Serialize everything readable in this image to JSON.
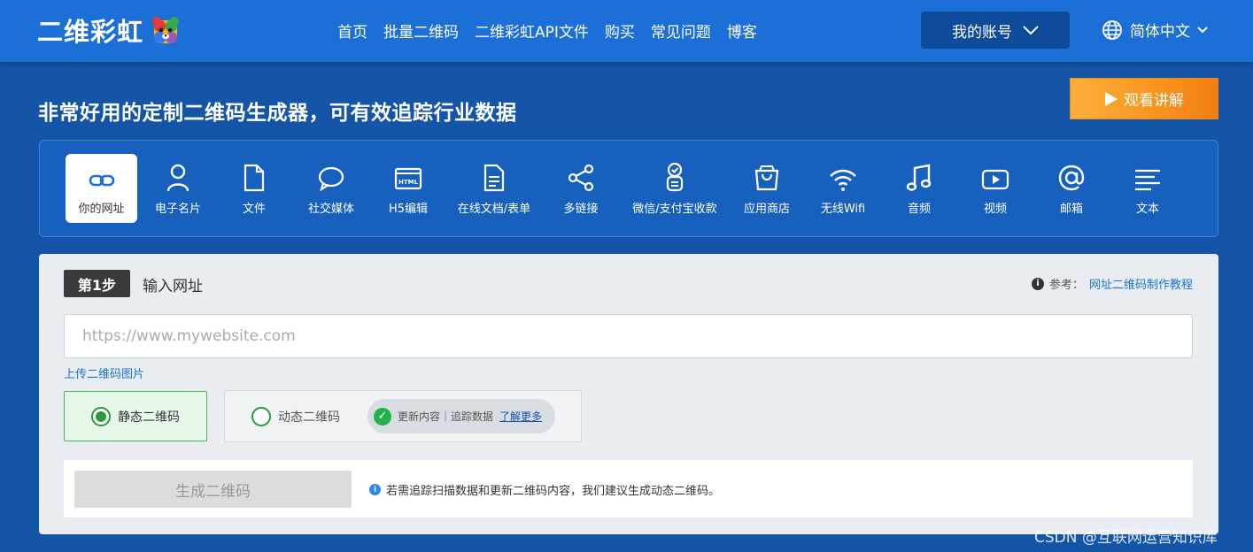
{
  "header": {
    "logo_text": "二维彩虹",
    "nav": [
      "首页",
      "批量二维码",
      "二维彩虹API文件",
      "购买",
      "常见问题",
      "博客"
    ],
    "account_label": "我的账号",
    "language_label": "简体中文"
  },
  "hero": {
    "headline": "非常好用的定制二维码生成器，可有效追踪行业数据",
    "watch_label": "观看讲解"
  },
  "types": [
    {
      "label": "你的网址",
      "icon": "link-icon",
      "active": true
    },
    {
      "label": "电子名片",
      "icon": "person-icon"
    },
    {
      "label": "文件",
      "icon": "file-icon"
    },
    {
      "label": "社交媒体",
      "icon": "chat-bubble-icon"
    },
    {
      "label": "H5编辑",
      "icon": "html-icon"
    },
    {
      "label": "在线文档/表单",
      "icon": "document-icon"
    },
    {
      "label": "多链接",
      "icon": "share-icon"
    },
    {
      "label": "微信/支付宝收款",
      "icon": "payment-icon"
    },
    {
      "label": "应用商店",
      "icon": "shopping-bag-icon"
    },
    {
      "label": "无线Wifi",
      "icon": "wifi-icon"
    },
    {
      "label": "音频",
      "icon": "music-icon"
    },
    {
      "label": "视频",
      "icon": "video-icon"
    },
    {
      "label": "邮箱",
      "icon": "at-icon"
    },
    {
      "label": "文本",
      "icon": "text-icon"
    }
  ],
  "step": {
    "badge": "第1步",
    "title": "输入网址",
    "ref_label": "参考：",
    "ref_link": "网址二维码制作教程"
  },
  "form": {
    "url_placeholder": "https://www.mywebsite.com",
    "upload_link": "上传二维码图片",
    "static_label": "静态二维码",
    "dynamic_label": "动态二维码",
    "dynamic_features": "更新内容｜追踪数据",
    "learn_more": "了解更多",
    "generate_label": "生成二维码",
    "note": "若需追踪扫描数据和更新二维码内容，我们建议生成动态二维码。"
  },
  "watermark": "CSDN @互联网运营知识库",
  "colors": {
    "header_bg": "#1b6fd6",
    "page_bg": "#1455a8",
    "accent_orange": "#f7941d",
    "accent_green": "#2a9a3c"
  }
}
